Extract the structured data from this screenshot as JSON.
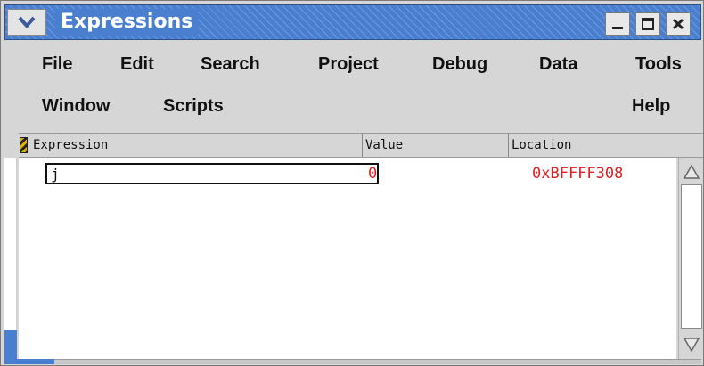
{
  "window": {
    "title": "Expressions",
    "accent_color": "#4a7fd0",
    "controls": {
      "menu_icon": "chevron-down-icon",
      "minimize_icon": "minimize-icon",
      "maximize_icon": "maximize-icon",
      "close_icon": "close-icon"
    }
  },
  "menubar": {
    "row1": [
      "File",
      "Edit",
      "Search",
      "Project",
      "Debug",
      "Data",
      "Tools"
    ],
    "row2_left": [
      "Window",
      "Scripts"
    ],
    "row2_right": "Help"
  },
  "table": {
    "columns": [
      "Expression",
      "Value",
      "Location"
    ],
    "rows": [
      {
        "expression": "j",
        "value": "0",
        "location": "0xBFFFF308"
      }
    ],
    "value_color": "#e02020"
  }
}
